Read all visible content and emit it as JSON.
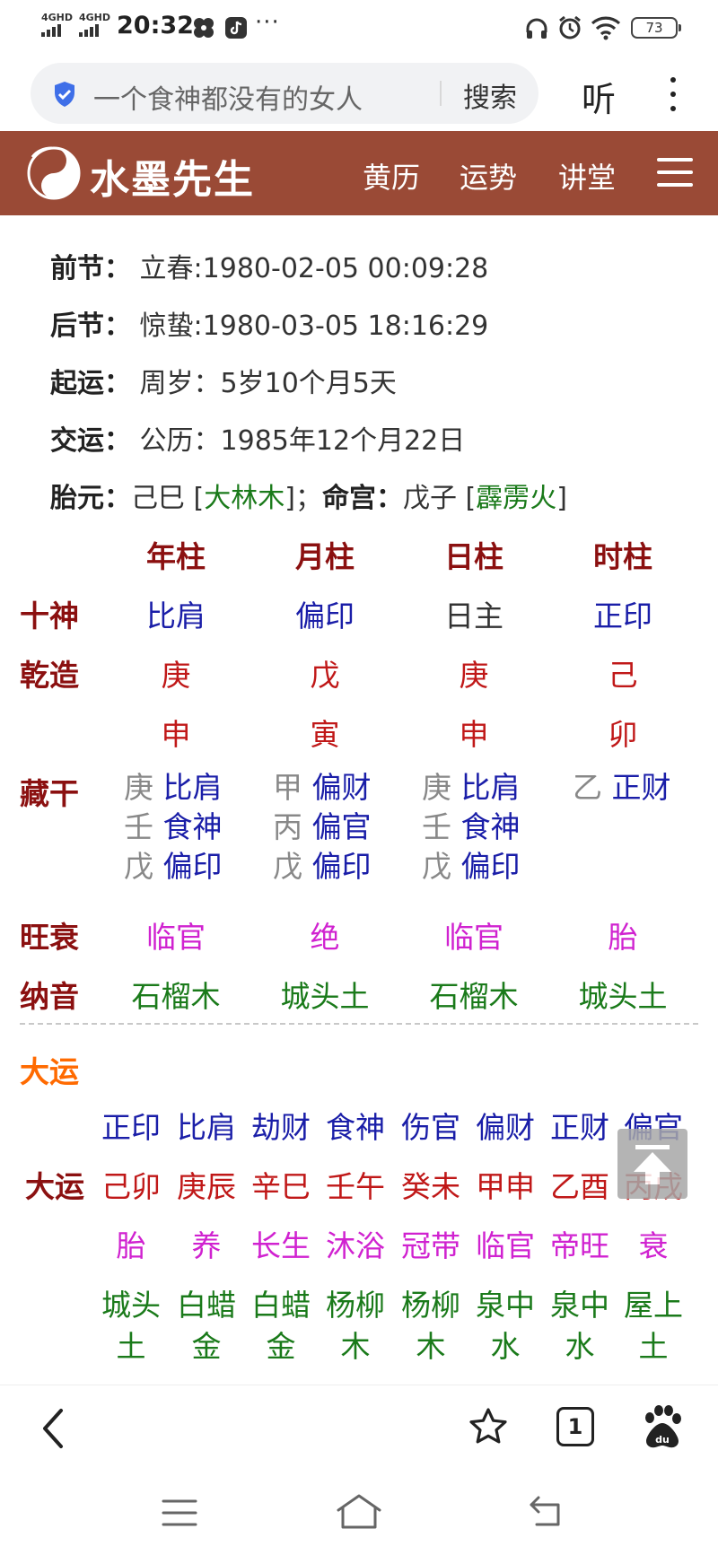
{
  "status_bar": {
    "net1": "4GHD",
    "net2": "4GHD",
    "time": "20:32",
    "more": "···",
    "battery": "73"
  },
  "browser": {
    "query": "一个食神都没有的女人",
    "search_label": "搜索",
    "listen_label": "听"
  },
  "site": {
    "logo_text": "水墨先生",
    "nav": [
      "黄历",
      "运势",
      "讲堂"
    ],
    "accent_color": "#9a4a36"
  },
  "info": {
    "prev_jie": {
      "label": "前节：",
      "value": "立春:1980-02-05 00:09:28"
    },
    "next_jie": {
      "label": "后节：",
      "value": "惊蛰:1980-03-05 18:16:29"
    },
    "qiyun": {
      "label": "起运：",
      "value": "周岁：5岁10个月5天"
    },
    "jiaoyun": {
      "label": "交运：",
      "value": "公历：1985年12个月22日"
    },
    "taiyuan": {
      "label": "胎元：",
      "value": "己巳 [",
      "nayin": "大林木",
      "sep": "]；",
      "minggong_label": "命宫：",
      "minggong_value": "戊子 [",
      "minggong_nayin": "霹雳火",
      "end": "]"
    }
  },
  "chart": {
    "columns": [
      "年柱",
      "月柱",
      "日柱",
      "时柱"
    ],
    "row_labels": {
      "shishen": "十神",
      "qianzao": "乾造",
      "canggan": "藏干",
      "wangshuai": "旺衰",
      "nayin": "纳音"
    },
    "shishen": [
      "比肩",
      "偏印",
      "日主",
      "正印"
    ],
    "stems": [
      "庚",
      "戊",
      "庚",
      "己"
    ],
    "branches": [
      "申",
      "寅",
      "申",
      "卯"
    ],
    "hidden": [
      [
        {
          "s": "庚",
          "g": "比肩"
        },
        {
          "s": "壬",
          "g": "食神"
        },
        {
          "s": "戊",
          "g": "偏印"
        }
      ],
      [
        {
          "s": "甲",
          "g": "偏财"
        },
        {
          "s": "丙",
          "g": "偏官"
        },
        {
          "s": "戊",
          "g": "偏印"
        }
      ],
      [
        {
          "s": "庚",
          "g": "比肩"
        },
        {
          "s": "壬",
          "g": "食神"
        },
        {
          "s": "戊",
          "g": "偏印"
        }
      ],
      [
        {
          "s": "乙",
          "g": "正财"
        }
      ]
    ],
    "wangshuai": [
      "临官",
      "绝",
      "临官",
      "胎"
    ],
    "nayin": [
      "石榴木",
      "城头土",
      "石榴木",
      "城头土"
    ]
  },
  "dayun": {
    "section_title": "大运",
    "row_label": "大运",
    "gods": [
      "正印",
      "比肩",
      "劫财",
      "食神",
      "伤官",
      "偏财",
      "正财",
      "偏官"
    ],
    "pillars": [
      "己卯",
      "庚辰",
      "辛巳",
      "壬午",
      "癸未",
      "甲申",
      "乙酉",
      "丙戌"
    ],
    "states": [
      "胎",
      "养",
      "长生",
      "沐浴",
      "冠带",
      "临官",
      "帝旺",
      "衰"
    ],
    "nayin_top": [
      "城头",
      "白蜡",
      "白蜡",
      "杨柳",
      "杨柳",
      "泉中",
      "泉中",
      "屋上"
    ],
    "nayin_bottom": [
      "土",
      "金",
      "金",
      "木",
      "木",
      "水",
      "水",
      "土"
    ]
  },
  "toolbar": {
    "tab_count": "1"
  }
}
